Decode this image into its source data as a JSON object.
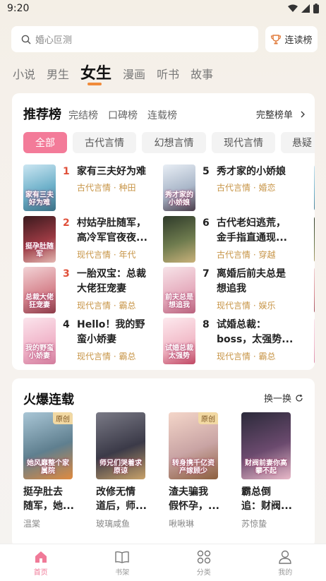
{
  "status": {
    "time": "9:20"
  },
  "search": {
    "placeholder": "婚心叵测"
  },
  "rank_button": {
    "label": "连读榜"
  },
  "channels": [
    "小说",
    "男生",
    "女生",
    "漫画",
    "听书",
    "故事"
  ],
  "recommend": {
    "title": "推荐榜",
    "subtabs": [
      "完结榜",
      "口碑榜",
      "连载榜"
    ],
    "more": "完整榜单",
    "genres": [
      "全部",
      "古代言情",
      "幻想言情",
      "现代言情",
      "悬疑"
    ],
    "books": [
      {
        "rank": "1",
        "title_line1": "家有三夫好为难",
        "title_line2": "",
        "genre": "古代言情",
        "author": "种田",
        "cover_text": "家有三夫好为难"
      },
      {
        "rank": "2",
        "title_line1": "村姑孕肚随军，",
        "title_line2": "高冷军官夜夜...",
        "genre": "现代言情",
        "author": "年代",
        "cover_text": "挺孕肚随军"
      },
      {
        "rank": "3",
        "title_line1": "一胎双宝：总裁",
        "title_line2": "大佬狂宠妻",
        "genre": "现代言情",
        "author": "霸总",
        "cover_text": "总裁大佬狂宠妻"
      },
      {
        "rank": "4",
        "title_line1": "Hello！我的野",
        "title_line2": "蛮小娇妻",
        "genre": "现代言情",
        "author": "霸总",
        "cover_text": "我的野蛮小娇妻"
      },
      {
        "rank": "5",
        "title_line1": "秀才家的小娇娘",
        "title_line2": "",
        "genre": "古代言情",
        "author": "婚恋",
        "cover_text": "秀才家的小娇娘"
      },
      {
        "rank": "6",
        "title_line1": "古代老妇逃荒，",
        "title_line2": "金手指直通现...",
        "genre": "古代言情",
        "author": "穿越",
        "cover_text": ""
      },
      {
        "rank": "7",
        "title_line1": "离婚后前夫总是",
        "title_line2": "想追我",
        "genre": "现代言情",
        "author": "娱乐",
        "cover_text": "前夫总是想追我"
      },
      {
        "rank": "8",
        "title_line1": "试婚总裁：",
        "title_line2": "boss，太强势...",
        "genre": "现代言情",
        "author": "霸总",
        "cover_text": "试婚总裁太强势"
      }
    ]
  },
  "serial": {
    "title": "火爆连载",
    "refresh": "换一换",
    "books": [
      {
        "title_line1": "挺孕肚去",
        "title_line2": "随军，她...",
        "author": "温棠",
        "badge": "原创",
        "cover_text": "她风靡整个家属院"
      },
      {
        "title_line1": "改修无情",
        "title_line2": "道后，师...",
        "author": "玻璃咸鱼",
        "badge": "",
        "cover_text": "师兄们哭着求原谅"
      },
      {
        "title_line1": "渣夫骗我",
        "title_line2": "假怀孕，...",
        "author": "啾啾琳",
        "badge": "原创",
        "cover_text": "转身携千亿资产嫁顾少"
      },
      {
        "title_line1": "霸总倒",
        "title_line2": "追：财阀...",
        "author": "苏惊蛰",
        "badge": "",
        "cover_text": "财阀前妻你高攀不起"
      }
    ]
  },
  "nav": [
    "首页",
    "书架",
    "分类",
    "我的"
  ],
  "colors": {
    "accent": "#f37b99",
    "rank_top": "#e0503a",
    "meta": "#c79446",
    "tab_indicator": "#f08a3a"
  }
}
